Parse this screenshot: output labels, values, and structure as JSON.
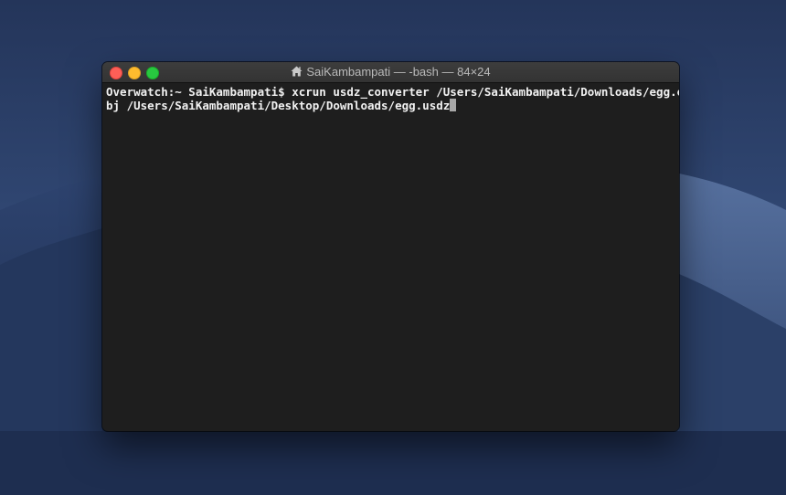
{
  "window": {
    "title": "SaiKambampati — -bash — 84×24"
  },
  "terminal": {
    "lines": [
      "Overwatch:~ SaiKambampati$ xcrun usdz_converter /Users/SaiKambampati/Downloads/egg.o",
      "bj /Users/SaiKambampati/Desktop/Downloads/egg.usdz"
    ]
  },
  "colors": {
    "close": "#fd5f57",
    "minimize": "#febb2e",
    "maximize": "#28c840",
    "terminal_bg": "#1e1e1e",
    "terminal_fg": "#f1f1f1"
  },
  "icons": {
    "title_icon": "home-icon"
  }
}
